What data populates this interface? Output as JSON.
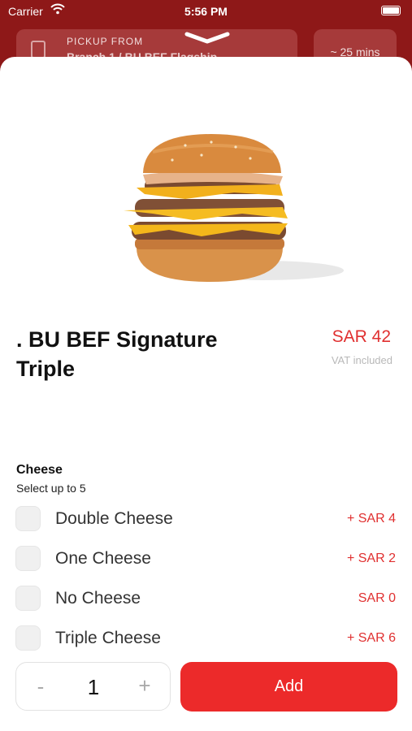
{
  "status_bar": {
    "carrier": "Carrier",
    "time": "5:56 PM"
  },
  "header": {
    "pickup_label": "PICKUP FROM",
    "store_name": "Branch 1 / BU BEF Flagship",
    "eta": "~ 25 mins"
  },
  "product": {
    "title": ". BU BEF Signature Triple",
    "price": "SAR 42",
    "vat_note": "VAT included",
    "image_icon": "burger-image"
  },
  "options_group": {
    "title": "Cheese",
    "subtitle": "Select up to 5",
    "items": [
      {
        "name": "Double Cheese",
        "price": "+  SAR 4"
      },
      {
        "name": "One Cheese",
        "price": "+  SAR 2"
      },
      {
        "name": "No Cheese",
        "price": "SAR 0"
      },
      {
        "name": "Triple Cheese",
        "price": "+  SAR 6"
      }
    ]
  },
  "quantity": {
    "minus": "-",
    "value": "1",
    "plus": "+"
  },
  "add_button": {
    "label": "Add"
  },
  "colors": {
    "accent": "#ec2a2a",
    "price": "#e03030",
    "backdrop": "#8e1818"
  }
}
